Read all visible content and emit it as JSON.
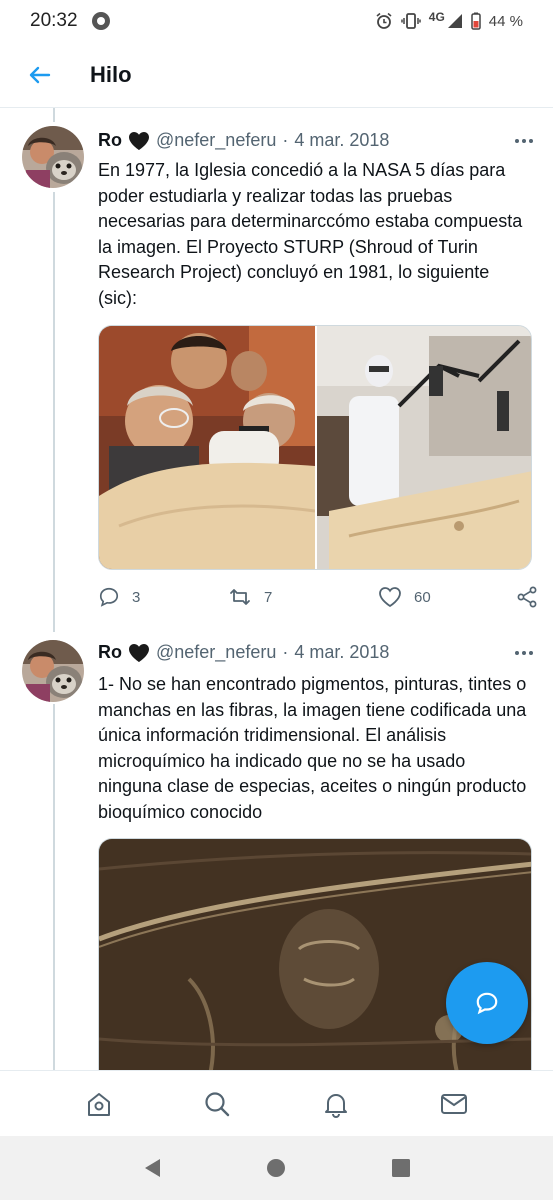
{
  "status_bar": {
    "time": "20:32",
    "network": "4G",
    "battery": "44 %"
  },
  "header": {
    "title": "Hilo"
  },
  "tweets": [
    {
      "name": "Ro",
      "handle": "@nefer_neferu",
      "separator": "·",
      "date": "4 mar. 2018",
      "text": "En 1977, la Iglesia concedió a la NASA 5 días para poder estudiarla y realizar todas las pruebas necesarias para determinarccómo estaba compuesta la imagen. El Proyecto STURP (Shroud of Turin Research Project) concluyó en 1981, lo siguiente (sic):",
      "replies": "3",
      "retweets": "7",
      "likes": "60"
    },
    {
      "name": "Ro",
      "handle": "@nefer_neferu",
      "separator": "·",
      "date": "4 mar. 2018",
      "text": "1- No se han encontrado pigmentos, pinturas, tintes o manchas en las fibras, la imagen tiene codificada una única información tridimensional. El análisis microquímico ha indicado que no se ha usado ninguna clase de especias, aceites o ningún producto bioquímico conocido"
    }
  ],
  "icons": {
    "back": "arrow-left-icon",
    "reply": "reply-icon",
    "retweet": "retweet-icon",
    "like": "heart-outline-icon",
    "share": "share-icon",
    "compose": "compose-reply-icon",
    "nav": [
      "home-icon",
      "search-icon",
      "notifications-icon",
      "messages-icon"
    ],
    "system": [
      "back-triangle-icon",
      "home-circle-icon",
      "recents-square-icon"
    ]
  },
  "colors": {
    "accent": "#1d9bf0",
    "text": "#0f1419",
    "muted": "#536471",
    "heart": "#1a1a1a"
  }
}
